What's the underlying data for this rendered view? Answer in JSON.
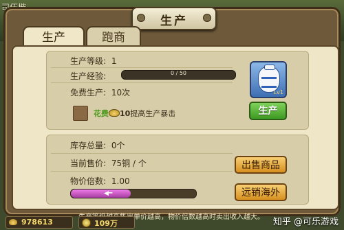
{
  "window": {
    "title": "生产",
    "background_label": "司伍楷"
  },
  "tabs": [
    {
      "label": "生产",
      "active": true
    },
    {
      "label": "跑商",
      "active": false
    }
  ],
  "production": {
    "level_label": "生产等级:",
    "level_value": "1",
    "exp_label": "生产经验:",
    "exp_value": "0 / 50",
    "exp_fraction": 0,
    "free_label": "免费生产:",
    "free_value": "10次",
    "flower_label": "花费",
    "cost_value": "10",
    "boost_text": "提高生产暴击",
    "produce_button": "生产",
    "item_icon": "porcelain-vase-icon",
    "item_level": "Lv1"
  },
  "sales": {
    "stock_label": "库存总量:",
    "stock_value": "0个",
    "price_label": "当前售价:",
    "price_value": "75铜 / 个",
    "multiplier_label": "物价倍数:",
    "multiplier_value": "1.00",
    "multiplier_fraction": 0.48,
    "sell_button": "出售商品",
    "export_button": "远销海外"
  },
  "footer_note": "生产等级越高售出单价越高，物价倍数越高时卖出收入越大。",
  "currency": {
    "gold": "978613",
    "coins": "109万"
  },
  "watermark": "知乎 @可乐游戏"
}
